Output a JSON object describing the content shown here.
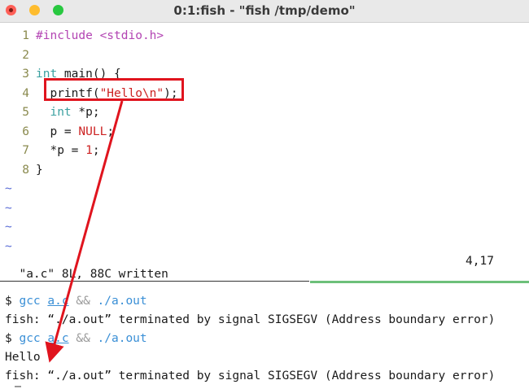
{
  "window": {
    "title": "0:1:fish - \"fish /tmp/demo\""
  },
  "editor": {
    "lines": [
      {
        "num": "1",
        "parts": [
          {
            "t": "#include <stdio.h>",
            "c": "pp"
          }
        ]
      },
      {
        "num": "2",
        "parts": []
      },
      {
        "num": "3",
        "parts": [
          {
            "t": "int",
            "c": "kw"
          },
          {
            "t": " main() {",
            "c": ""
          }
        ]
      },
      {
        "num": "4",
        "parts": [
          {
            "t": "  printf(",
            "c": ""
          },
          {
            "t": "\"Hello\\n\"",
            "c": "str"
          },
          {
            "t": ");",
            "c": ""
          }
        ]
      },
      {
        "num": "5",
        "parts": [
          {
            "t": "  ",
            "c": ""
          },
          {
            "t": "int",
            "c": "kw"
          },
          {
            "t": " *p;",
            "c": ""
          }
        ]
      },
      {
        "num": "6",
        "parts": [
          {
            "t": "  p = ",
            "c": ""
          },
          {
            "t": "NULL",
            "c": "str"
          },
          {
            "t": ";",
            "c": ""
          }
        ]
      },
      {
        "num": "7",
        "parts": [
          {
            "t": "  *p = ",
            "c": ""
          },
          {
            "t": "1",
            "c": "str"
          },
          {
            "t": ";",
            "c": ""
          }
        ]
      },
      {
        "num": "8",
        "parts": [
          {
            "t": "}",
            "c": ""
          }
        ]
      }
    ],
    "tilde": "~",
    "tilde_count": 4,
    "status_message": "\"a.c\" 8L, 88C written",
    "cursor_position": "4,17"
  },
  "terminal": {
    "lines": [
      {
        "parts": [
          {
            "t": "$ ",
            "c": ""
          },
          {
            "t": "gcc",
            "c": "gcc"
          },
          {
            "t": " ",
            "c": ""
          },
          {
            "t": "a.c",
            "c": "file"
          },
          {
            "t": " && ",
            "c": "op"
          },
          {
            "t": "./a.out",
            "c": "gcc"
          }
        ]
      },
      {
        "parts": [
          {
            "t": "fish: “./a.out” terminated by signal SIGSEGV (Address boundary error)",
            "c": ""
          }
        ]
      },
      {
        "parts": [
          {
            "t": "$ ",
            "c": ""
          },
          {
            "t": "gcc",
            "c": "gcc"
          },
          {
            "t": " ",
            "c": ""
          },
          {
            "t": "a.c",
            "c": "file"
          },
          {
            "t": " && ",
            "c": "op"
          },
          {
            "t": "./a.out",
            "c": "gcc"
          }
        ]
      },
      {
        "parts": [
          {
            "t": "Hello",
            "c": ""
          }
        ]
      },
      {
        "parts": [
          {
            "t": "fish: “./a.out” terminated by signal SIGSEGV (Address boundary error)",
            "c": ""
          }
        ]
      }
    ]
  },
  "annotation": {
    "box_color": "#e0141e",
    "arrow_color": "#e0141e"
  }
}
